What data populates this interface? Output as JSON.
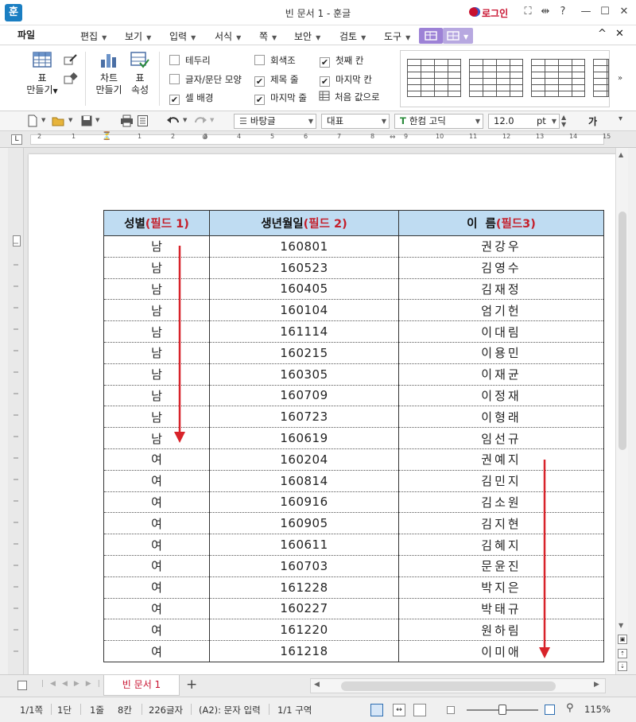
{
  "window": {
    "logo": "훈",
    "title": "빈 문서 1 - 훈글",
    "login": "로그인",
    "controls": [
      "fullscreen-icon",
      "split-icon",
      "help-icon",
      "minimize-icon",
      "maximize-icon",
      "close-icon"
    ]
  },
  "menu": {
    "file": "파일",
    "items": [
      "편집",
      "보기",
      "입력",
      "서식",
      "쪽",
      "보안",
      "검토",
      "도구"
    ]
  },
  "ribbon": {
    "table_label1": "표",
    "table_label2": "만들기",
    "chart_label1": "차트",
    "chart_label2": "만들기",
    "props_label1": "표",
    "props_label2": "속성",
    "checks": [
      {
        "label": "테두리",
        "checked": false
      },
      {
        "label": "글자/문단 모양",
        "checked": false
      },
      {
        "label": "셀 배경",
        "checked": true
      },
      {
        "label": "회색조",
        "checked": false
      },
      {
        "label": "제목 줄",
        "checked": true
      },
      {
        "label": "마지막 줄",
        "checked": true
      },
      {
        "label": "첫째 칸",
        "checked": true
      },
      {
        "label": "마지막 칸",
        "checked": true
      }
    ],
    "reset_label": "처음 값으로"
  },
  "toolbar": {
    "style": "바탕글",
    "lang": "대표",
    "font": "한컴 고딕",
    "size": "12.0",
    "unit": "pt",
    "bold_char": "가"
  },
  "ruler": {
    "ticks": [
      "2",
      "1",
      "1",
      "2",
      "3",
      "4",
      "5",
      "6",
      "7",
      "8",
      "9",
      "10",
      "11",
      "12",
      "13",
      "14",
      "15"
    ]
  },
  "table": {
    "headers": [
      {
        "main": "성별",
        "field": "(필드  1)"
      },
      {
        "main": "생년월일",
        "field": "(필드  2)"
      },
      {
        "main": "이  름",
        "field": "(필드3)"
      }
    ],
    "rows": [
      [
        "남",
        "160801",
        "권강우"
      ],
      [
        "남",
        "160523",
        "김영수"
      ],
      [
        "남",
        "160405",
        "김재정"
      ],
      [
        "남",
        "160104",
        "엄기헌"
      ],
      [
        "남",
        "161114",
        "이대림"
      ],
      [
        "남",
        "160215",
        "이용민"
      ],
      [
        "남",
        "160305",
        "이재균"
      ],
      [
        "남",
        "160709",
        "이정재"
      ],
      [
        "남",
        "160723",
        "이형래"
      ],
      [
        "남",
        "160619",
        "임선규"
      ],
      [
        "여",
        "160204",
        "권예지"
      ],
      [
        "여",
        "160814",
        "김민지"
      ],
      [
        "여",
        "160916",
        "김소원"
      ],
      [
        "여",
        "160905",
        "김지현"
      ],
      [
        "여",
        "160611",
        "김혜지"
      ],
      [
        "여",
        "160703",
        "문윤진"
      ],
      [
        "여",
        "161228",
        "박지은"
      ],
      [
        "여",
        "160227",
        "박태규"
      ],
      [
        "여",
        "161220",
        "원하림"
      ],
      [
        "여",
        "161218",
        "이미애"
      ]
    ],
    "arrow_color": "#d8232a"
  },
  "tabs": {
    "doc_tab": "빈 문서 1",
    "add": "+"
  },
  "status": {
    "page": "1/1쪽",
    "column": "1단",
    "line": "1줄",
    "col": "8칸",
    "chars": "226글자",
    "mode": "(A2): 문자 입력",
    "section": "1/1 구역",
    "zoom": "115%"
  }
}
